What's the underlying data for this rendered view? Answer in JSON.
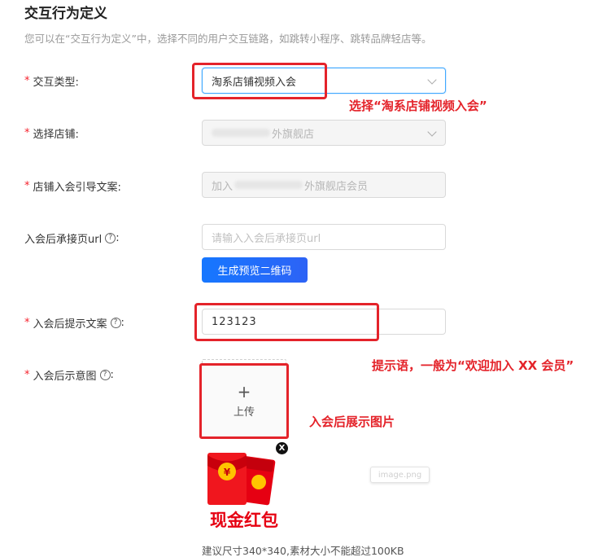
{
  "header": {
    "title": "交互行为定义",
    "description": "您可以在“交互行为定义”中，选择不同的用户交互链路，如跳转小程序、跳转品牌轻店等。"
  },
  "form": {
    "required_mark": "*",
    "interaction_type": {
      "label": "交互类型:",
      "value": "淘系店铺视频入会"
    },
    "store": {
      "label": "选择店铺:",
      "value_suffix": "外旗舰店"
    },
    "join_text": {
      "label": "店铺入会引导文案:",
      "value_prefix": "加入",
      "value_suffix": "外旗舰店会员"
    },
    "landing_url": {
      "label": "入会后承接页url",
      "placeholder": "请输入入会后承接页url"
    },
    "qr_button": {
      "label": "生成预览二维码"
    },
    "prompt_text": {
      "label": "入会后提示文案",
      "value": "123123"
    },
    "image": {
      "label": "入会后示意图",
      "upload_plus": "+",
      "upload_label": "上传",
      "close": "X",
      "thumb_text": "现金红包",
      "file_tag": "image.png",
      "size_hint": "建议尺寸340*340,素材大小不能超过100KB"
    },
    "help_icon": "?",
    "colon": ":"
  },
  "annotations": {
    "select_type": "选择“淘系店铺视频入会”",
    "prompt_example": "提示语，一般为“欢迎加入 XX 会员”",
    "image_note": "入会后展示图片"
  },
  "colors": {
    "annotation_red": "#e4232a",
    "primary_blue": "#1677ff",
    "required_red": "#f5222d"
  }
}
